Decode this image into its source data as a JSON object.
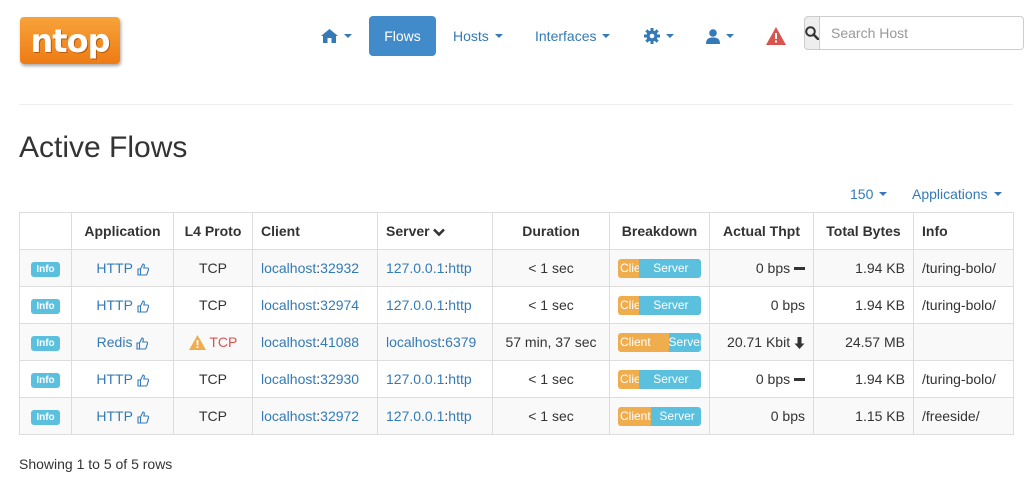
{
  "brand": {
    "logo_text": "ntop"
  },
  "navbar": {
    "flows_label": "Flows",
    "hosts_label": "Hosts",
    "interfaces_label": "Interfaces",
    "search_placeholder": "Search Host"
  },
  "page": {
    "title": "Active Flows"
  },
  "toolbar": {
    "page_size": "150",
    "filter_label": "Applications"
  },
  "table": {
    "headers": {
      "application": "Application",
      "l4": "L4 Proto",
      "client": "Client",
      "server": "Server",
      "duration": "Duration",
      "breakdown": "Breakdown",
      "thpt": "Actual Thpt",
      "bytes": "Total Bytes",
      "info": "Info"
    },
    "rows": [
      {
        "badge": "Info",
        "app": "HTTP",
        "proto": "TCP",
        "client_host": "localhost",
        "client_port": "32932",
        "server_host": "127.0.0.1",
        "server_port": "http",
        "duration": "< 1 sec",
        "bd_client": "Client",
        "bd_server": "Server",
        "bd_client_pct": 25,
        "thpt": "0 bps",
        "bytes": "1.94 KB",
        "info": "/turing-bolo/"
      },
      {
        "badge": "Info",
        "app": "HTTP",
        "proto": "TCP",
        "client_host": "localhost",
        "client_port": "32974",
        "server_host": "127.0.0.1",
        "server_port": "http",
        "duration": "< 1 sec",
        "bd_client": "Client",
        "bd_server": "Server",
        "bd_client_pct": 25,
        "thpt": "0 bps",
        "bytes": "1.94 KB",
        "info": "/turing-bolo/"
      },
      {
        "badge": "Info",
        "app": "Redis",
        "proto": "TCP",
        "client_host": "localhost",
        "client_port": "41088",
        "server_host": "localhost",
        "server_port": "6379",
        "duration": "57 min, 37 sec",
        "bd_client": "Client",
        "bd_server": "Server",
        "bd_client_pct": 62,
        "thpt": "20.71 Kbit",
        "bytes": "24.57 MB",
        "info": ""
      },
      {
        "badge": "Info",
        "app": "HTTP",
        "proto": "TCP",
        "client_host": "localhost",
        "client_port": "32930",
        "server_host": "127.0.0.1",
        "server_port": "http",
        "duration": "< 1 sec",
        "bd_client": "Client",
        "bd_server": "Server",
        "bd_client_pct": 25,
        "thpt": "0 bps",
        "bytes": "1.94 KB",
        "info": "/turing-bolo/"
      },
      {
        "badge": "Info",
        "app": "HTTP",
        "proto": "TCP",
        "client_host": "localhost",
        "client_port": "32972",
        "server_host": "127.0.0.1",
        "server_port": "http",
        "duration": "< 1 sec",
        "bd_client": "Client",
        "bd_server": "Server",
        "bd_client_pct": 40,
        "thpt": "0 bps",
        "bytes": "1.15 KB",
        "info": "/freeside/"
      }
    ]
  },
  "footer": {
    "summary": "Showing 1 to 5 of 5 rows"
  },
  "colors": {
    "accent": "#337ab7",
    "active_nav": "#428bca",
    "client_bar": "#f0ad4e",
    "server_bar": "#5bc0de",
    "alert": "#d9534f",
    "warning": "#f0ad4e"
  },
  "icons": [
    "home-icon",
    "gear-icon",
    "user-icon",
    "warning-triangle-icon",
    "search-icon",
    "thumbs-up-icon",
    "minus-icon",
    "arrow-down-icon"
  ]
}
